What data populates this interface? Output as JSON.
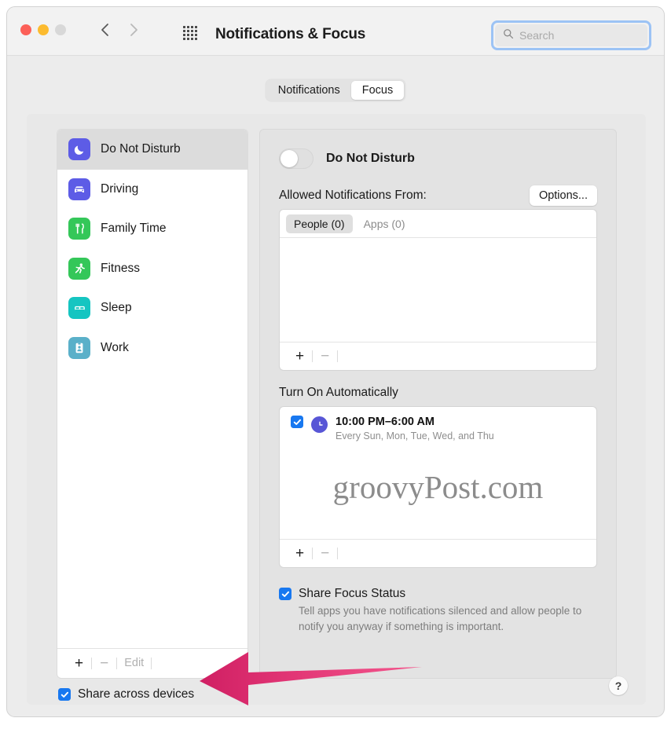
{
  "window": {
    "title": "Notifications & Focus",
    "traffic_lights": [
      "close-red",
      "minimize-yellow",
      "zoom-gray"
    ],
    "back_label": "‹",
    "forward_label": "›",
    "grid_icon": "all-preferences-grid-icon",
    "search": {
      "placeholder": "Search",
      "value": "",
      "icon": "search-icon",
      "focus_ring_color": "#9cc3f5"
    }
  },
  "tabs": {
    "items": [
      {
        "label": "Notifications",
        "active": false
      },
      {
        "label": "Focus",
        "active": true
      }
    ]
  },
  "sidebar": {
    "items": [
      {
        "label": "Do Not Disturb",
        "icon": "moon-icon",
        "color": "#5d5ce6",
        "selected": true
      },
      {
        "label": "Driving",
        "icon": "car-icon",
        "color": "#5d5ce6",
        "selected": false
      },
      {
        "label": "Family Time",
        "icon": "fork-knife-icon",
        "color": "#34c759",
        "selected": false
      },
      {
        "label": "Fitness",
        "icon": "running-person-icon",
        "color": "#34c759",
        "selected": false
      },
      {
        "label": "Sleep",
        "icon": "bed-icon",
        "color": "#15c5c1",
        "selected": false
      },
      {
        "label": "Work",
        "icon": "badge-person-icon",
        "color": "#5ab0c9",
        "selected": false
      }
    ],
    "footer": {
      "add_label": "+",
      "remove_label": "−",
      "edit_label": "Edit"
    },
    "share_across_devices": {
      "label": "Share across devices",
      "checked": true
    }
  },
  "detail": {
    "toggle": {
      "label": "Do Not Disturb",
      "state": "off"
    },
    "allowed": {
      "label": "Allowed Notifications From:",
      "options_button": "Options..."
    },
    "allowed_list": {
      "tabs": [
        {
          "label": "People (0)",
          "active": true
        },
        {
          "label": "Apps (0)",
          "active": false
        }
      ],
      "rows": [],
      "footer": {
        "add_label": "+",
        "remove_label": "−"
      }
    },
    "turn_on": {
      "section_title": "Turn On Automatically",
      "schedules": [
        {
          "checked": true,
          "icon": "clock-icon",
          "time": "10:00 PM–6:00 AM",
          "repeat": "Every Sun, Mon, Tue, Wed, and Thu"
        }
      ],
      "footer": {
        "add_label": "+",
        "remove_label": "−"
      }
    },
    "share_focus_status": {
      "title": "Share Focus Status",
      "checked": true,
      "description": "Tell apps you have notifications silenced and allow people to notify you anyway if something is important."
    },
    "help_button": "?"
  },
  "watermark": {
    "text": "groovyPost.com"
  },
  "annotation": {
    "arrow": {
      "name": "pink-arrow-annotation",
      "direction": "left",
      "color_start": "#f4588e",
      "color_end": "#d01f63"
    }
  }
}
